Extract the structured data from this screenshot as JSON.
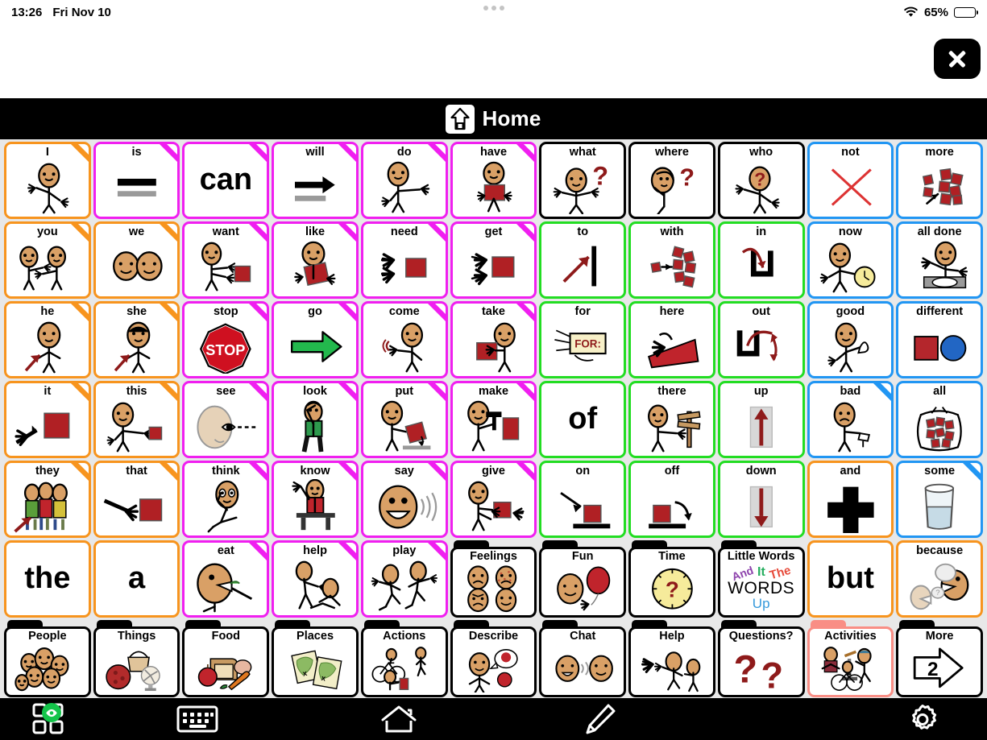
{
  "status_bar": {
    "time": "13:26",
    "date": "Fri Nov 10",
    "battery_percent": "65%",
    "wifi_icon": "wifi-icon",
    "battery_icon": "battery-icon"
  },
  "close_button": {
    "icon": "close-icon",
    "label": ""
  },
  "title_bar": {
    "title": "Home",
    "icon": "home-icon"
  },
  "grid": {
    "rows": 7,
    "columns": 11,
    "cells": [
      {
        "label": "I",
        "art": "person-pointing-self",
        "border": "#F7941E",
        "fold": true,
        "type": "word"
      },
      {
        "label": "is",
        "art": "equals-bars",
        "border": "#F01FF0",
        "fold": true,
        "type": "word"
      },
      {
        "label": "",
        "art": "text",
        "text": "can",
        "border": "#F01FF0",
        "fold": true,
        "type": "text"
      },
      {
        "label": "will",
        "art": "arrow-right-bar",
        "border": "#F01FF0",
        "fold": true,
        "type": "word"
      },
      {
        "label": "do",
        "art": "person-reaching",
        "border": "#F01FF0",
        "fold": true,
        "type": "word"
      },
      {
        "label": "have",
        "art": "person-holding-box",
        "border": "#F01FF0",
        "fold": true,
        "type": "word"
      },
      {
        "label": "what",
        "art": "person-question",
        "border": "#000000",
        "fold": false,
        "type": "word"
      },
      {
        "label": "where",
        "art": "person-looking-question",
        "border": "#000000",
        "fold": false,
        "type": "word"
      },
      {
        "label": "who",
        "art": "person-question-head",
        "border": "#000000",
        "fold": false,
        "type": "word"
      },
      {
        "label": "not",
        "art": "red-x",
        "border": "#2196F3",
        "fold": false,
        "type": "word"
      },
      {
        "label": "more",
        "art": "many-blocks-arrow",
        "border": "#2196F3",
        "fold": false,
        "type": "word"
      },
      {
        "label": "you",
        "art": "two-people-pointing",
        "border": "#F7941E",
        "fold": true,
        "type": "word"
      },
      {
        "label": "we",
        "art": "two-faces",
        "border": "#F7941E",
        "fold": true,
        "type": "word"
      },
      {
        "label": "want",
        "art": "person-reach-box",
        "border": "#F01FF0",
        "fold": true,
        "type": "word"
      },
      {
        "label": "like",
        "art": "person-hug-box",
        "border": "#F01FF0",
        "fold": true,
        "type": "word"
      },
      {
        "label": "need",
        "art": "hands-box",
        "border": "#F01FF0",
        "fold": true,
        "type": "word"
      },
      {
        "label": "get",
        "art": "hands-grab-box",
        "border": "#F01FF0",
        "fold": true,
        "type": "word"
      },
      {
        "label": "to",
        "art": "arrow-to-line",
        "border": "#22DD22",
        "fold": false,
        "type": "word"
      },
      {
        "label": "with",
        "art": "blocks-joining",
        "border": "#22DD22",
        "fold": false,
        "type": "word"
      },
      {
        "label": "in",
        "art": "arrow-into-container",
        "border": "#22DD22",
        "fold": false,
        "type": "word"
      },
      {
        "label": "now",
        "art": "person-clock",
        "border": "#2196F3",
        "fold": false,
        "type": "word"
      },
      {
        "label": "all done",
        "art": "person-empty-plate",
        "border": "#2196F3",
        "fold": false,
        "type": "word"
      },
      {
        "label": "he",
        "art": "person-arrow-male",
        "border": "#F7941E",
        "fold": true,
        "type": "word"
      },
      {
        "label": "she",
        "art": "person-arrow-female",
        "border": "#F7941E",
        "fold": true,
        "type": "word"
      },
      {
        "label": "stop",
        "art": "stop-sign",
        "border": "#F01FF0",
        "fold": true,
        "type": "word"
      },
      {
        "label": "go",
        "art": "green-arrow",
        "border": "#F01FF0",
        "fold": true,
        "type": "word"
      },
      {
        "label": "come",
        "art": "person-beckoning",
        "border": "#F01FF0",
        "fold": true,
        "type": "word"
      },
      {
        "label": "take",
        "art": "person-taking-box",
        "border": "#F01FF0",
        "fold": true,
        "type": "word"
      },
      {
        "label": "for",
        "art": "for-tag",
        "border": "#22DD22",
        "fold": false,
        "type": "word"
      },
      {
        "label": "here",
        "art": "hand-on-surface",
        "border": "#22DD22",
        "fold": false,
        "type": "word"
      },
      {
        "label": "out",
        "art": "arrow-out-container",
        "border": "#22DD22",
        "fold": false,
        "type": "word"
      },
      {
        "label": "good",
        "art": "person-thumbs-up",
        "border": "#2196F3",
        "fold": false,
        "type": "word"
      },
      {
        "label": "different",
        "art": "square-and-circle",
        "border": "#2196F3",
        "fold": false,
        "type": "word"
      },
      {
        "label": "it",
        "art": "hand-pointing-box",
        "border": "#F7941E",
        "fold": true,
        "type": "word"
      },
      {
        "label": "this",
        "art": "person-pointing-box",
        "border": "#F7941E",
        "fold": true,
        "type": "word"
      },
      {
        "label": "see",
        "art": "eye-sightline",
        "border": "#F01FF0",
        "fold": true,
        "type": "word"
      },
      {
        "label": "look",
        "art": "person-walking-looking",
        "border": "#F01FF0",
        "fold": true,
        "type": "word"
      },
      {
        "label": "put",
        "art": "person-placing-box",
        "border": "#F01FF0",
        "fold": true,
        "type": "word"
      },
      {
        "label": "make",
        "art": "person-hammer-box",
        "border": "#F01FF0",
        "fold": true,
        "type": "word"
      },
      {
        "label": "",
        "art": "text",
        "text": "of",
        "border": "#22DD22",
        "fold": false,
        "type": "text"
      },
      {
        "label": "there",
        "art": "person-signpost",
        "border": "#22DD22",
        "fold": false,
        "type": "word"
      },
      {
        "label": "up",
        "art": "up-arrow-box",
        "border": "#22DD22",
        "fold": false,
        "type": "word"
      },
      {
        "label": "bad",
        "art": "person-thumbs-down",
        "border": "#2196F3",
        "fold": true,
        "type": "word"
      },
      {
        "label": "all",
        "art": "bag-of-blocks",
        "border": "#2196F3",
        "fold": false,
        "type": "word"
      },
      {
        "label": "they",
        "art": "group-arrow",
        "border": "#F7941E",
        "fold": true,
        "type": "word"
      },
      {
        "label": "that",
        "art": "hand-point-far-box",
        "border": "#F7941E",
        "fold": true,
        "type": "word"
      },
      {
        "label": "think",
        "art": "person-thinking",
        "border": "#F01FF0",
        "fold": true,
        "type": "word"
      },
      {
        "label": "know",
        "art": "person-raising-hand",
        "border": "#F01FF0",
        "fold": true,
        "type": "word"
      },
      {
        "label": "say",
        "art": "face-speaking",
        "border": "#F01FF0",
        "fold": true,
        "type": "word"
      },
      {
        "label": "give",
        "art": "person-giving-box",
        "border": "#F01FF0",
        "fold": true,
        "type": "word"
      },
      {
        "label": "on",
        "art": "box-onto-surface",
        "border": "#22DD22",
        "fold": false,
        "type": "word"
      },
      {
        "label": "off",
        "art": "box-off-surface",
        "border": "#22DD22",
        "fold": false,
        "type": "word"
      },
      {
        "label": "down",
        "art": "down-arrow-box",
        "border": "#22DD22",
        "fold": false,
        "type": "word"
      },
      {
        "label": "and",
        "art": "plus-sign",
        "border": "#F7941E",
        "fold": false,
        "type": "word"
      },
      {
        "label": "some",
        "art": "half-full-glass",
        "border": "#2196F3",
        "fold": true,
        "type": "word"
      },
      {
        "label": "",
        "art": "text",
        "text": "the",
        "border": "#F7941E",
        "fold": false,
        "type": "text"
      },
      {
        "label": "",
        "art": "text",
        "text": "a",
        "border": "#F7941E",
        "fold": false,
        "type": "text"
      },
      {
        "label": "eat",
        "art": "person-eating",
        "border": "#F01FF0",
        "fold": true,
        "type": "word"
      },
      {
        "label": "help",
        "art": "person-helping",
        "border": "#F01FF0",
        "fold": true,
        "type": "word"
      },
      {
        "label": "play",
        "art": "two-people-running",
        "border": "#F01FF0",
        "fold": true,
        "type": "word"
      },
      {
        "label": "Feelings",
        "art": "four-emotion-faces",
        "border": "#000000",
        "fold": false,
        "type": "folder"
      },
      {
        "label": "Fun",
        "art": "face-balloon",
        "border": "#000000",
        "fold": false,
        "type": "folder"
      },
      {
        "label": "Time",
        "art": "clock-question",
        "border": "#000000",
        "fold": false,
        "type": "folder"
      },
      {
        "label": "Little Words",
        "art": "little-words-art",
        "border": "#000000",
        "fold": false,
        "type": "folder"
      },
      {
        "label": "",
        "art": "text",
        "text": "but",
        "border": "#F7941E",
        "fold": false,
        "type": "text"
      },
      {
        "label": "because",
        "art": "two-faces-speech",
        "border": "#F7941E",
        "fold": false,
        "type": "word"
      },
      {
        "label": "People",
        "art": "crowd-of-faces",
        "border": "#000000",
        "fold": false,
        "type": "folder"
      },
      {
        "label": "Things",
        "art": "basket-ball-fan",
        "border": "#000000",
        "fold": false,
        "type": "folder"
      },
      {
        "label": "Food",
        "art": "bread-apple-carrot",
        "border": "#000000",
        "fold": false,
        "type": "folder"
      },
      {
        "label": "Places",
        "art": "two-maps",
        "border": "#000000",
        "fold": false,
        "type": "folder"
      },
      {
        "label": "Actions",
        "art": "cyclist-walker",
        "border": "#000000",
        "fold": false,
        "type": "folder"
      },
      {
        "label": "Describe",
        "art": "person-speech-apple",
        "border": "#000000",
        "fold": false,
        "type": "folder"
      },
      {
        "label": "Chat",
        "art": "two-faces-talking",
        "border": "#000000",
        "fold": false,
        "type": "folder"
      },
      {
        "label": "Help",
        "art": "person-helping-up",
        "border": "#000000",
        "fold": false,
        "type": "folder"
      },
      {
        "label": "Questions?",
        "art": "two-question-marks",
        "border": "#000000",
        "fold": false,
        "type": "folder"
      },
      {
        "label": "Activities",
        "art": "activities-people",
        "border": "#F98E85",
        "fold": false,
        "type": "folder",
        "selected": true
      },
      {
        "label": "More",
        "art": "arrow-two",
        "text": "2",
        "border": "#000000",
        "fold": false,
        "type": "folder"
      }
    ]
  },
  "little_words_art": {
    "word_and": "And",
    "word_it": "It",
    "word_the": "The",
    "word_words": "WORDS",
    "word_up": "Up",
    "color_and": "#8e44ad",
    "color_it": "#27ae60",
    "color_the": "#e74c3c",
    "color_words": "#000000",
    "color_up": "#3498db"
  },
  "more_button": {
    "number": "2"
  },
  "toolbar": {
    "items": [
      {
        "name": "grid-view-button",
        "icon": "grid-icon",
        "badge": "eye-icon"
      },
      {
        "name": "keyboard-button",
        "icon": "keyboard-icon"
      },
      {
        "name": "home-button",
        "icon": "home-outline-icon"
      },
      {
        "name": "edit-button",
        "icon": "pencil-icon"
      },
      {
        "name": "settings-button",
        "icon": "gear-icon"
      }
    ]
  },
  "colors": {
    "pronoun_orange": "#F7941E",
    "verb_magenta": "#F01FF0",
    "question_black": "#000000",
    "descriptor_blue": "#2196F3",
    "preposition_green": "#22DD22",
    "selected_salmon": "#F98E85",
    "grid_background": "#E8E8E8",
    "bar_black": "#000000",
    "skin": "#D9A066",
    "red_block": "#B02024"
  }
}
